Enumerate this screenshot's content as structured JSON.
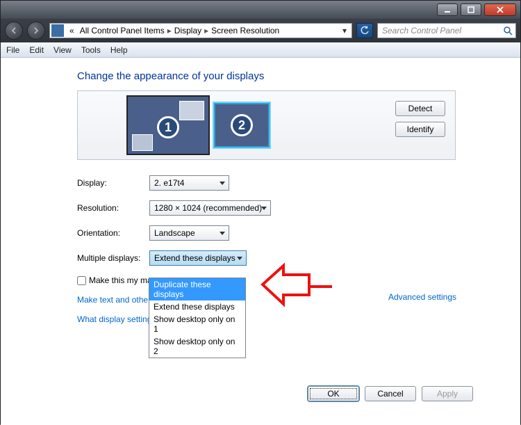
{
  "titlebar": {
    "min": "minimize",
    "max": "maximize",
    "close": "close"
  },
  "breadcrumb": {
    "chev": "«",
    "p1": "All Control Panel Items",
    "p2": "Display",
    "p3": "Screen Resolution"
  },
  "search": {
    "placeholder": "Search Control Panel"
  },
  "menu": {
    "file": "File",
    "edit": "Edit",
    "view": "View",
    "tools": "Tools",
    "help": "Help"
  },
  "heading": "Change the appearance of your displays",
  "monitors": {
    "num1": "1",
    "num2": "2"
  },
  "sidebtns": {
    "detect": "Detect",
    "identify": "Identify"
  },
  "labels": {
    "display": "Display:",
    "resolution": "Resolution:",
    "orientation": "Orientation:",
    "multi": "Multiple displays:"
  },
  "values": {
    "display": "2. e17t4",
    "resolution": "1280 × 1024 (recommended)",
    "orientation": "Landscape",
    "multi": "Extend these displays"
  },
  "multiOptions": {
    "o1": "Duplicate these displays",
    "o2": "Extend these displays",
    "o3": "Show desktop only on 1",
    "o4": "Show desktop only on 2"
  },
  "checkbox": "Make this my ma",
  "link1": "Make text and other",
  "link2": "What display settings should I choose?",
  "advanced": "Advanced settings",
  "footer": {
    "ok": "OK",
    "cancel": "Cancel",
    "apply": "Apply"
  }
}
